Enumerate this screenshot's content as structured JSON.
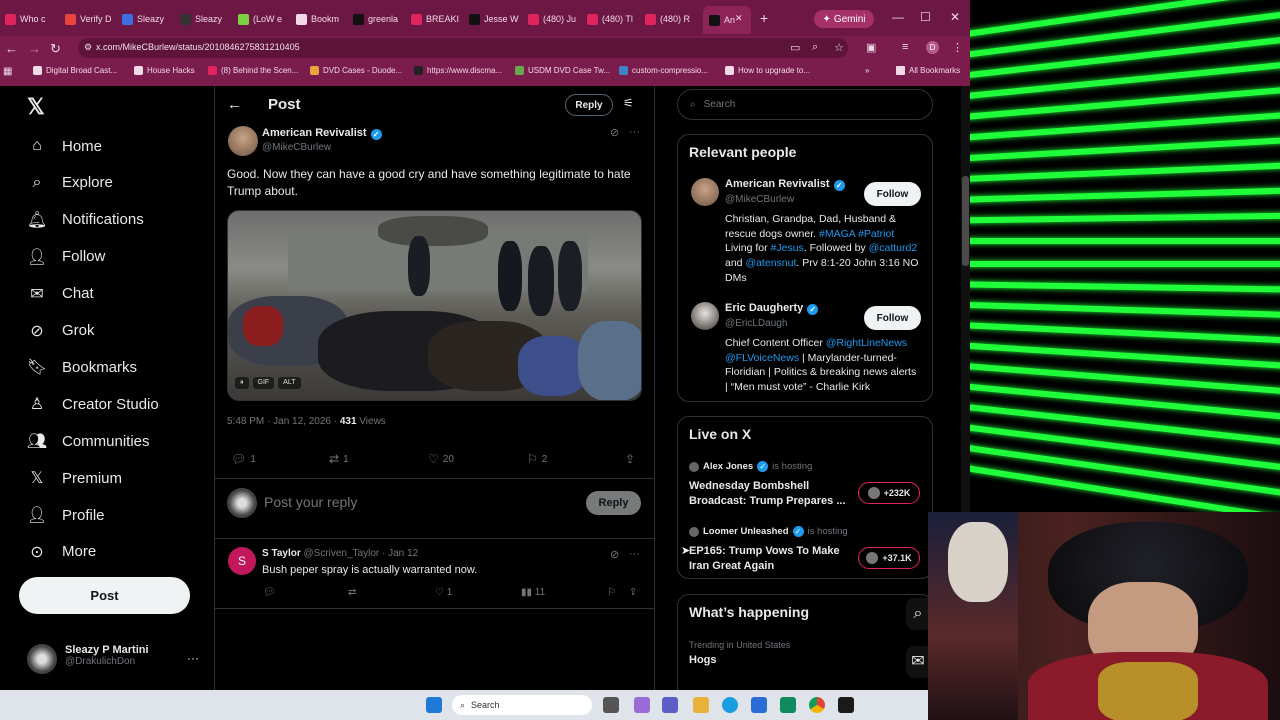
{
  "browser": {
    "tabs": [
      {
        "label": "Who c",
        "color": "#e0245e"
      },
      {
        "label": "Verify D",
        "color": "#e8453c"
      },
      {
        "label": "Sleazy",
        "color": "#3d6de0"
      },
      {
        "label": "Sleazy",
        "color": "#333333"
      },
      {
        "label": "(LoW e",
        "color": "#7cd142"
      },
      {
        "label": "Bookm",
        "color": "#f1d9e5"
      },
      {
        "label": "greenla",
        "color": "#111111"
      },
      {
        "label": "BREAKI",
        "color": "#e0245e"
      },
      {
        "label": "Jesse W",
        "color": "#111111"
      },
      {
        "label": "(480) Ju",
        "color": "#e0245e"
      },
      {
        "label": "(480) Tl",
        "color": "#e0245e"
      },
      {
        "label": "(480) R",
        "color": "#e0245e"
      },
      {
        "label": "An",
        "color": "#111111"
      }
    ],
    "new_tab": "+",
    "gemini_label": "Gemini",
    "url": "x.com/MikeCBurlew/status/2010846275831210405",
    "avatar_letter": "D",
    "bookmarks": [
      "Digital Broad Cast...",
      "House Hacks",
      "(8) Behind the Scen...",
      "DVD Cases - Duode...",
      "https://www.discma...",
      "USDM DVD Case Tw...",
      "custom-compressio...",
      "How to upgrade to..."
    ],
    "all_bookmarks": "All Bookmarks"
  },
  "sidebar": {
    "logo": "𝕏",
    "items": [
      {
        "label": "Home",
        "icon": "home-icon",
        "glyph": "⌂"
      },
      {
        "label": "Explore",
        "icon": "search-icon",
        "glyph": "⌕"
      },
      {
        "label": "Notifications",
        "icon": "bell-icon",
        "glyph": "🔔︎"
      },
      {
        "label": "Follow",
        "icon": "person-add-icon",
        "glyph": "👤︎"
      },
      {
        "label": "Chat",
        "icon": "mail-icon",
        "glyph": "✉"
      },
      {
        "label": "Grok",
        "icon": "grok-icon",
        "glyph": "⊘"
      },
      {
        "label": "Bookmarks",
        "icon": "bookmark-icon",
        "glyph": "🔖︎"
      },
      {
        "label": "Creator Studio",
        "icon": "creator-icon",
        "glyph": "♙"
      },
      {
        "label": "Communities",
        "icon": "communities-icon",
        "glyph": "👥︎"
      },
      {
        "label": "Premium",
        "icon": "x-premium-icon",
        "glyph": "𝕏"
      },
      {
        "label": "Profile",
        "icon": "profile-icon",
        "glyph": "👤︎"
      },
      {
        "label": "More",
        "icon": "more-circle-icon",
        "glyph": "⊙"
      }
    ],
    "post_button": "Post",
    "account": {
      "name": "Sleazy P Martini",
      "handle": "@DrakulichDon",
      "more": "···"
    }
  },
  "post": {
    "header_title": "Post",
    "reply_top": "Reply",
    "author": {
      "name": "American Revivalist",
      "handle": "@MikeCBurlew"
    },
    "text": "Good. Now they can have a good cry and have something legitimate to hate Trump about.",
    "media_controls": [
      "⏸",
      "GIF",
      "ALT"
    ],
    "meta": {
      "time": "5:48 PM · Jan 12, 2026 · ",
      "views": "431",
      "views_label": " Views"
    },
    "actions": {
      "replies": "1",
      "reposts": "1",
      "likes": "20",
      "bookmarks": "2"
    },
    "reply_placeholder": "Post your reply",
    "reply_button": "Reply"
  },
  "comment": {
    "avatar_letter": "S",
    "name": "S Taylor",
    "handle_date": "@Scriven_Taylor · Jan 12",
    "text": "Bush peper spray is actually warranted now.",
    "likes": "1",
    "views": "11"
  },
  "right": {
    "search_placeholder": "Search",
    "relevant_title": "Relevant people",
    "people": [
      {
        "name": "American Revivalist",
        "handle": "@MikeCBurlew",
        "follow": "Follow",
        "bio": [
          {
            "t": "Christian, Grandpa, Dad, Husband & rescue dogs owner. ",
            "c": ""
          },
          {
            "t": "#MAGA #Patriot",
            "c": "blue"
          },
          {
            "t": " Living for ",
            "c": ""
          },
          {
            "t": "#Jesus",
            "c": "blue"
          },
          {
            "t": ". Followed by ",
            "c": ""
          },
          {
            "t": "@catturd2",
            "c": "blue"
          },
          {
            "t": " and ",
            "c": ""
          },
          {
            "t": "@atensnut",
            "c": "blue"
          },
          {
            "t": ". Prv 8:1-20 John 3:16 NO DMs",
            "c": ""
          }
        ]
      },
      {
        "name": "Eric Daugherty",
        "handle": "@EricLDaugh",
        "follow": "Follow",
        "bio": [
          {
            "t": "Chief Content Officer ",
            "c": ""
          },
          {
            "t": "@RightLineNews",
            "c": "blue"
          },
          {
            "t": " ",
            "c": ""
          },
          {
            "t": "@FLVoiceNews",
            "c": "blue"
          },
          {
            "t": " | Marylander-turned-Floridian | Politics & breaking news alerts | “Men must vote” - Charlie Kirk",
            "c": ""
          }
        ]
      }
    ],
    "live_title": "Live on X",
    "spaces": [
      {
        "host": "Alex Jones",
        "hosting": "is hosting",
        "title": "Wednesday Bombshell Broadcast: Trump Prepares ...",
        "count": "+232K"
      },
      {
        "host": "Loomer Unleashed",
        "hosting": "is hosting",
        "title": "EP165: Trump Vows To Make Iran Great Again",
        "count": "+37.1K"
      }
    ],
    "happening_title": "What’s happening",
    "trend_meta": "Trending in United States",
    "trend": "Hogs"
  },
  "taskbar": {
    "search": "Search"
  }
}
